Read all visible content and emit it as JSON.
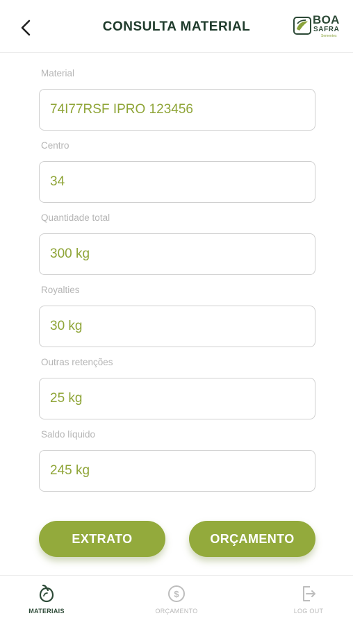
{
  "header": {
    "title": "CONSULTA MATERIAL",
    "logo_main": "BOA",
    "logo_sub": "SAFRA",
    "logo_tag": "Sementes"
  },
  "fields": [
    {
      "label": "Material",
      "value": "74I77RSF IPRO 123456"
    },
    {
      "label": "Centro",
      "value": "34"
    },
    {
      "label": "Quantidade total",
      "value": "300 kg"
    },
    {
      "label": "Royalties",
      "value": "30 kg"
    },
    {
      "label": "Outras retenções",
      "value": "25 kg"
    },
    {
      "label": "Saldo líquido",
      "value": "245 kg"
    }
  ],
  "actions": {
    "extrato": "EXTRATO",
    "orcamento": "ORÇAMENTO"
  },
  "nav": {
    "materiais": "MATERIAIS",
    "orcamento": "ORÇAMENTO",
    "logout": "LOG OUT",
    "active": "materiais"
  },
  "colors": {
    "accent": "#93aa3c",
    "value_text": "#8fa538",
    "title": "#1f3b2c",
    "label": "#b5b5b5"
  }
}
